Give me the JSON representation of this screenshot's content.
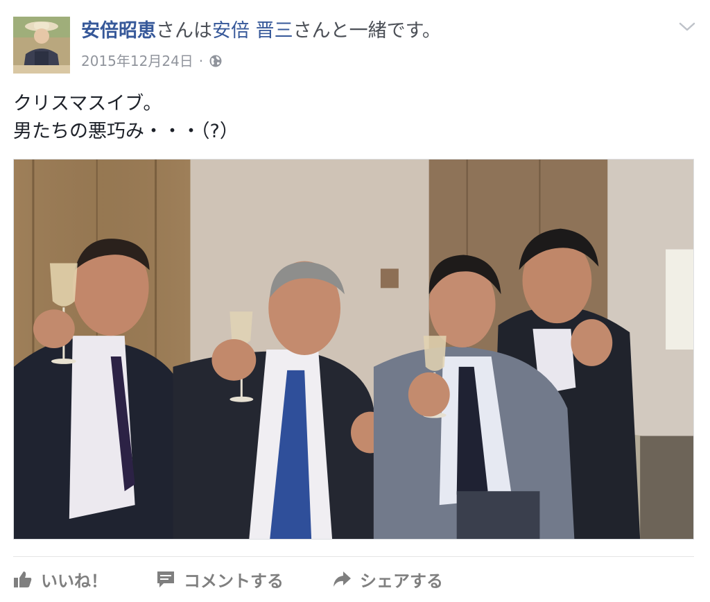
{
  "post": {
    "author": "安倍昭恵",
    "with_text": "さんは",
    "tagged": "安倍 晋三",
    "with_suffix": "さんと一緒です。",
    "date": "2015年12月24日",
    "separator": "·",
    "privacy_icon": "globe-icon",
    "menu_icon": "chevron-down-icon",
    "text_lines": [
      "クリスマスイブ。",
      "男たちの悪巧み・・・（?）"
    ]
  },
  "actions": [
    {
      "icon": "thumbs-up-icon",
      "label": "いいね！"
    },
    {
      "icon": "comment-icon",
      "label": "コメントする"
    },
    {
      "icon": "share-arrow-icon",
      "label": "シェアする"
    }
  ],
  "colors": {
    "link": "#365899",
    "meta": "#90949c",
    "action": "#7f7f7f"
  }
}
